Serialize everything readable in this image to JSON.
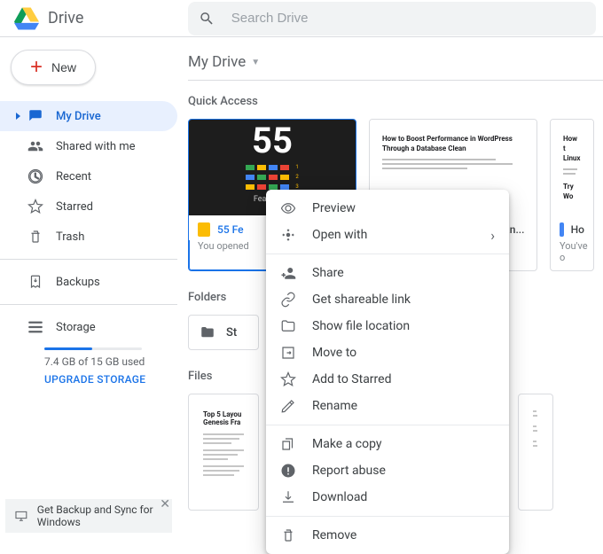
{
  "header": {
    "product": "Drive",
    "search_placeholder": "Search Drive"
  },
  "sidebar": {
    "new_label": "New",
    "items": [
      {
        "label": "My Drive"
      },
      {
        "label": "Shared with me"
      },
      {
        "label": "Recent"
      },
      {
        "label": "Starred"
      },
      {
        "label": "Trash"
      }
    ],
    "backups_label": "Backups",
    "storage_label": "Storage",
    "used_text": "7.4 GB of 15 GB used",
    "upgrade_label": "UPGRADE STORAGE",
    "used_percent": 49
  },
  "breadcrumb": {
    "label": "My Drive"
  },
  "sections": {
    "quick_access": "Quick Access",
    "folders": "Folders",
    "files": "Files"
  },
  "quick_access": [
    {
      "name": "55 Fe",
      "sub": "You opened",
      "thumb_caption": "Features E"
    },
    {
      "name": "How to Boost Performan...",
      "sub": "",
      "doc_title": "How to Boost Performance in WordPress Through a Database Clean"
    },
    {
      "name": "Ho",
      "sub": "You've o",
      "doc_title": "How t\nLinux",
      "extra_title": "Try Wo"
    }
  ],
  "folders": [
    {
      "name": "St"
    }
  ],
  "files": [
    {
      "title": "Top 5 Layou\nGenesis Fra"
    },
    {
      "title": ""
    }
  ],
  "context_menu": {
    "groups": [
      [
        {
          "id": "preview",
          "label": "Preview",
          "icon": "eye"
        },
        {
          "id": "openwith",
          "label": "Open with",
          "icon": "move-cross",
          "arrow": true
        }
      ],
      [
        {
          "id": "share",
          "label": "Share",
          "icon": "person-plus"
        },
        {
          "id": "link",
          "label": "Get shareable link",
          "icon": "link"
        },
        {
          "id": "location",
          "label": "Show file location",
          "icon": "folder"
        },
        {
          "id": "moveto",
          "label": "Move to",
          "icon": "move-to"
        },
        {
          "id": "star",
          "label": "Add to Starred",
          "icon": "star"
        },
        {
          "id": "rename",
          "label": "Rename",
          "icon": "pencil"
        }
      ],
      [
        {
          "id": "copy",
          "label": "Make a copy",
          "icon": "copy"
        },
        {
          "id": "report",
          "label": "Report abuse",
          "icon": "alert"
        },
        {
          "id": "download",
          "label": "Download",
          "icon": "download"
        }
      ],
      [
        {
          "id": "remove",
          "label": "Remove",
          "icon": "trash"
        }
      ]
    ]
  },
  "banner": {
    "text": "Get Backup and Sync for Windows"
  }
}
